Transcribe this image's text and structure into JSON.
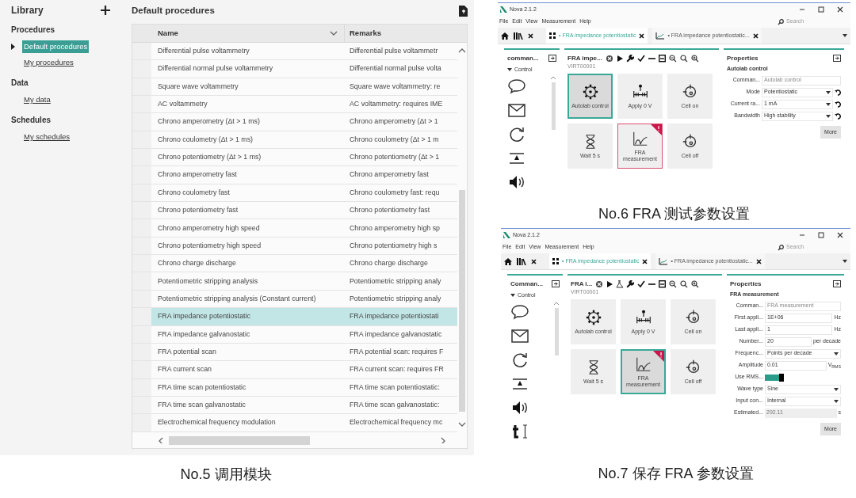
{
  "library": {
    "title": "Library",
    "sections": [
      {
        "title": "Procedures",
        "items": [
          {
            "label": "Default procedures",
            "selected": true
          },
          {
            "label": "My procedures",
            "selected": false
          }
        ]
      },
      {
        "title": "Data",
        "items": [
          {
            "label": "My data",
            "selected": false
          }
        ]
      },
      {
        "title": "Schedules",
        "items": [
          {
            "label": "My schedules",
            "selected": false
          }
        ]
      }
    ],
    "heading": "Default procedures",
    "table": {
      "columns": [
        "Name",
        "Remarks"
      ],
      "rows": [
        {
          "name": "Differential pulse voltammetry",
          "remarks": "Differential pulse voltammetr",
          "selected": false
        },
        {
          "name": "Differential normal pulse voltammetry",
          "remarks": "Differential normal pulse volta",
          "selected": false
        },
        {
          "name": "Square wave voltammetry",
          "remarks": "Square wave voltammetry: re",
          "selected": false
        },
        {
          "name": "AC voltammetry",
          "remarks": "AC voltammetry: requires IME",
          "selected": false
        },
        {
          "name": "Chrono amperometry (Δt > 1 ms)",
          "remarks": "Chrono amperometry (Δt > 1",
          "selected": false
        },
        {
          "name": "Chrono coulometry (Δt > 1 ms)",
          "remarks": "Chrono coulometry (Δt > 1 m",
          "selected": false
        },
        {
          "name": "Chrono potentiometry (Δt > 1 ms)",
          "remarks": "Chrono potentiometry (Δt > 1",
          "selected": false
        },
        {
          "name": "Chrono amperometry fast",
          "remarks": "Chrono amperometry fast",
          "selected": false
        },
        {
          "name": "Chrono coulometry fast",
          "remarks": "Chrono coulometry fast: requ",
          "selected": false
        },
        {
          "name": "Chrono potentiometry fast",
          "remarks": "Chrono potentiometry fast",
          "selected": false
        },
        {
          "name": "Chrono amperometry high speed",
          "remarks": "Chrono amperometry high sp",
          "selected": false
        },
        {
          "name": "Chrono potentiometry high speed",
          "remarks": "Chrono potentiometry high s",
          "selected": false
        },
        {
          "name": "Chrono charge discharge",
          "remarks": "Chrono charge discharge",
          "selected": false
        },
        {
          "name": "Potentiometric stripping analysis",
          "remarks": "Potentiometric stripping analy",
          "selected": false
        },
        {
          "name": "Potentiometric stripping analysis (Constant current)",
          "remarks": "Potentiometric stripping analy",
          "selected": false
        },
        {
          "name": "FRA impedance potentiostatic",
          "remarks": "FRA impedance potentiostati",
          "selected": true
        },
        {
          "name": "FRA impedance galvanostatic",
          "remarks": "FRA impedance galvanostatic",
          "selected": false
        },
        {
          "name": "FRA potential scan",
          "remarks": "FRA potential scan: requires F",
          "selected": false
        },
        {
          "name": "FRA current scan",
          "remarks": "FRA current scan: requires FR",
          "selected": false
        },
        {
          "name": "FRA time scan potentiostatic",
          "remarks": "FRA time scan potentiostatic:",
          "selected": false
        },
        {
          "name": "FRA time scan galvanostatic",
          "remarks": "FRA time scan galvanostatic:",
          "selected": false
        },
        {
          "name": "Electrochemical frequency modulation",
          "remarks": "Electrochemical frequency mc",
          "selected": false
        }
      ]
    },
    "caption": "No.5 调用模块"
  },
  "windows": [
    {
      "title": "Nova 2.1.2",
      "menu": [
        "File",
        "Edit",
        "View",
        "Measurement",
        "Help"
      ],
      "search_placeholder": "Search",
      "tabs": [
        {
          "kind": "procedure",
          "label": "• FRA impedance potentiostatic",
          "selected": true
        },
        {
          "kind": "data",
          "label": "• FRA impedance potentiostatic...",
          "selected": false
        }
      ],
      "commands": {
        "title": "comman...",
        "group": "Control"
      },
      "procedure": {
        "title": "FRA impe...",
        "device": "VIRT00001",
        "toolbar": [
          {
            "kind": "stop"
          },
          {
            "kind": "play"
          },
          {
            "kind": "wrench"
          },
          {
            "kind": "check"
          },
          {
            "kind": "minus"
          },
          {
            "kind": "save"
          },
          {
            "kind": "zoom-out"
          },
          {
            "kind": "zoom"
          },
          {
            "kind": "zoom-in"
          }
        ],
        "tiles": [
          {
            "kind": "gear",
            "label": "Autolab control",
            "selected": true,
            "warning": false
          },
          {
            "kind": "apply",
            "label": "Apply 0 V",
            "selected": false,
            "warning": false
          },
          {
            "kind": "cell",
            "label": "Cell on",
            "selected": false,
            "warning": false
          },
          {
            "kind": "wait",
            "label": "Wait 5 s",
            "selected": false,
            "warning": false
          },
          {
            "kind": "fra",
            "label": "FRA measurement",
            "selected": false,
            "warning": true
          },
          {
            "kind": "cell",
            "label": "Cell off",
            "selected": false,
            "warning": false
          }
        ]
      },
      "properties": {
        "title": "Properties",
        "subtitle": "Autolab control",
        "fields": [
          {
            "kind": "text",
            "label": "Comman...",
            "value": "Autolab control",
            "disabled": true
          },
          {
            "kind": "select",
            "label": "Mode",
            "value": "Potentiostatic",
            "reset": true
          },
          {
            "kind": "select",
            "label": "Current ra...",
            "value": "1 mA",
            "reset": true
          },
          {
            "kind": "select",
            "label": "Bandwidth",
            "value": "High stability",
            "reset": true
          }
        ],
        "button": "More"
      },
      "caption": "No.6 FRA 测试参数设置"
    },
    {
      "title": "Nova 2.1.2",
      "menu": [
        "File",
        "Edit",
        "View",
        "Measurement",
        "Help"
      ],
      "search_placeholder": "Search",
      "tabs": [
        {
          "kind": "procedure",
          "label": "• FRA impedance potentiostatic",
          "selected": true
        },
        {
          "kind": "data",
          "label": "• FRA impedance potentiostatic...",
          "selected": false
        }
      ],
      "commands": {
        "title": "Comman...",
        "group": "Control"
      },
      "procedure": {
        "title": "FRA i...",
        "device": "VIRT00001",
        "toolbar": [
          {
            "kind": "stop"
          },
          {
            "kind": "play"
          },
          {
            "kind": "flask"
          },
          {
            "kind": "wrench"
          },
          {
            "kind": "check"
          },
          {
            "kind": "minus"
          },
          {
            "kind": "save"
          },
          {
            "kind": "zoom-out"
          },
          {
            "kind": "zoom"
          },
          {
            "kind": "zoom-in"
          }
        ],
        "tiles": [
          {
            "kind": "gear",
            "label": "Autolab control",
            "selected": false,
            "warning": false
          },
          {
            "kind": "apply",
            "label": "Apply 0 V",
            "selected": false,
            "warning": false
          },
          {
            "kind": "cell",
            "label": "Cell on",
            "selected": false,
            "warning": false
          },
          {
            "kind": "wait",
            "label": "Wait 5 s",
            "selected": false,
            "warning": false
          },
          {
            "kind": "fra",
            "label": "FRA measurement",
            "selected": true,
            "warning": true
          },
          {
            "kind": "cell",
            "label": "Cell off",
            "selected": false,
            "warning": false
          }
        ]
      },
      "properties": {
        "title": "Properties",
        "subtitle": "FRA measurement",
        "fields": [
          {
            "kind": "text",
            "label": "Comman...",
            "value": "FRA measurement",
            "disabled": true
          },
          {
            "kind": "text",
            "label": "First appli...",
            "value": "1E+06",
            "unit": "Hz",
            "disabled": false
          },
          {
            "kind": "text",
            "label": "Last appli...",
            "value": "1",
            "unit": "Hz",
            "disabled": false
          },
          {
            "kind": "text",
            "label": "Number...",
            "value": "20",
            "unit": "per decade",
            "disabled": false
          },
          {
            "kind": "select",
            "label": "Frequenc...",
            "value": "Points per decade"
          },
          {
            "kind": "text",
            "label": "Amplitude",
            "value": "0.01",
            "unit": "V$_{RMS}$",
            "disabled": false
          },
          {
            "kind": "toggle",
            "label": "Use RMS...",
            "on": true
          },
          {
            "kind": "select",
            "label": "Wave type",
            "value": "Sine"
          },
          {
            "kind": "select",
            "label": "Input con...",
            "value": "Internal"
          },
          {
            "kind": "readonly",
            "label": "Estimated...",
            "value": "292.11",
            "unit": "s"
          }
        ],
        "button": "More"
      },
      "caption": "No.7 保存 FRA 参数设置"
    }
  ]
}
